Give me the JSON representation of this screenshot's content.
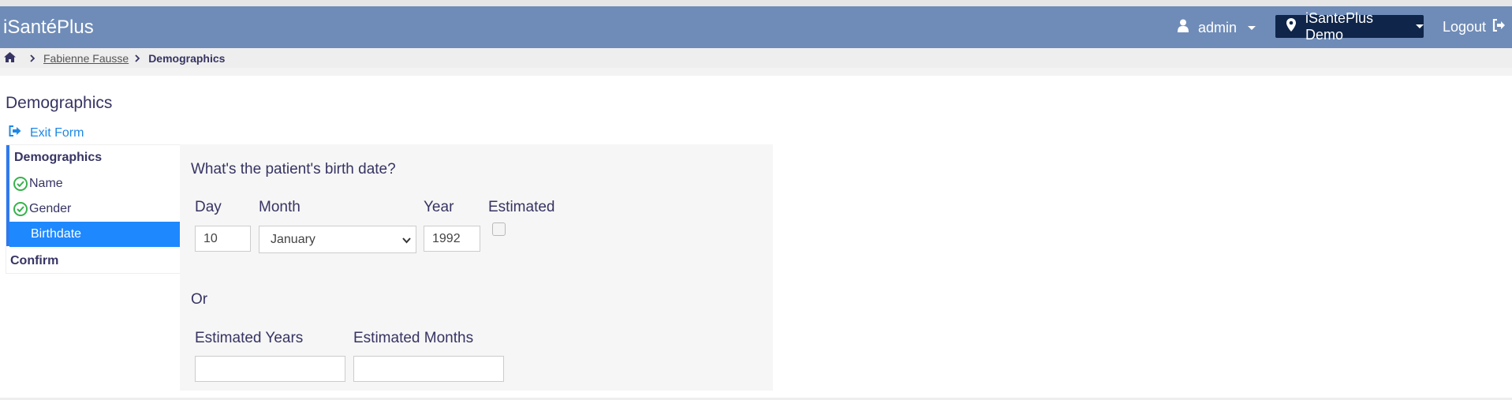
{
  "header": {
    "brand": "iSantéPlus",
    "user_label": "admin",
    "location_label": "iSantePlus Demo",
    "logout_label": "Logout"
  },
  "breadcrumb": {
    "patient": "Fabienne Fausse",
    "current": "Demographics"
  },
  "page": {
    "title": "Demographics",
    "exit_label": "Exit Form"
  },
  "sidenav": {
    "section": "Demographics",
    "items": [
      {
        "label": "Name",
        "done": true
      },
      {
        "label": "Gender",
        "done": true
      },
      {
        "label": "Birthdate",
        "done": false,
        "active": true
      }
    ],
    "confirm": "Confirm"
  },
  "form": {
    "question": "What's the patient's birth date?",
    "day_label": "Day",
    "month_label": "Month",
    "year_label": "Year",
    "estimated_label": "Estimated",
    "day_value": "10",
    "month_value": "January",
    "year_value": "1992",
    "estimated_checked": false,
    "or_label": "Or",
    "est_years_label": "Estimated Years",
    "est_months_label": "Estimated Months",
    "est_years_value": "",
    "est_months_value": ""
  },
  "colors": {
    "header": "#6f8cb8",
    "location_bg": "#0f2549",
    "active_nav": "#1e88ff",
    "link": "#1e88e5",
    "check": "#37b24d"
  },
  "icons": [
    "user-icon",
    "map-marker-icon",
    "logout-icon",
    "home-icon",
    "chevron-right-icon",
    "exit-icon",
    "check-circle-icon",
    "chevron-down-icon"
  ]
}
